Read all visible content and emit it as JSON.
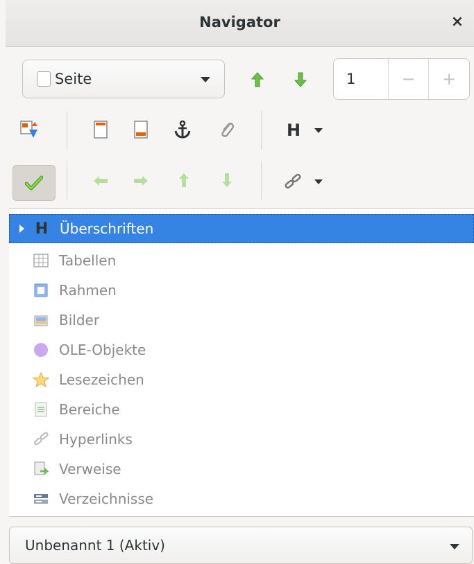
{
  "window": {
    "title": "Navigator",
    "close_symbol": "×"
  },
  "toolbar": {
    "content_type": {
      "label": "Seite",
      "checked": false
    },
    "page_number": {
      "value": "1",
      "minus_symbol": "−",
      "plus_symbol": "+"
    },
    "icons_row1": [
      "toggle-content-icon",
      "header-icon",
      "footer-icon",
      "anchor-icon",
      "attachment-icon",
      "heading-level-icon"
    ],
    "icons_row2": [
      "checkmark-icon",
      "promote-left-icon",
      "demote-right-icon",
      "move-up-icon",
      "move-down-icon",
      "link-dropdown-icon"
    ],
    "heading_symbol": "H"
  },
  "tree": {
    "items": [
      {
        "label": "Überschriften",
        "icon": "heading-icon",
        "selected": true
      },
      {
        "label": "Tabellen",
        "icon": "table-icon",
        "selected": false
      },
      {
        "label": "Rahmen",
        "icon": "frame-icon",
        "selected": false
      },
      {
        "label": "Bilder",
        "icon": "image-icon",
        "selected": false
      },
      {
        "label": "OLE-Objekte",
        "icon": "ole-object-icon",
        "selected": false
      },
      {
        "label": "Lesezeichen",
        "icon": "star-icon",
        "selected": false
      },
      {
        "label": "Bereiche",
        "icon": "section-icon",
        "selected": false
      },
      {
        "label": "Hyperlinks",
        "icon": "link-icon",
        "selected": false
      },
      {
        "label": "Verweise",
        "icon": "reference-icon",
        "selected": false
      },
      {
        "label": "Verzeichnisse",
        "icon": "index-icon",
        "selected": false
      }
    ]
  },
  "document_selector": {
    "label": "Unbenannt 1 (Aktiv)"
  },
  "colors": {
    "selection": "#3584e4",
    "green_arrow": "#6cc04a",
    "orange": "#e66100",
    "muted_text": "#8a8a8a"
  }
}
